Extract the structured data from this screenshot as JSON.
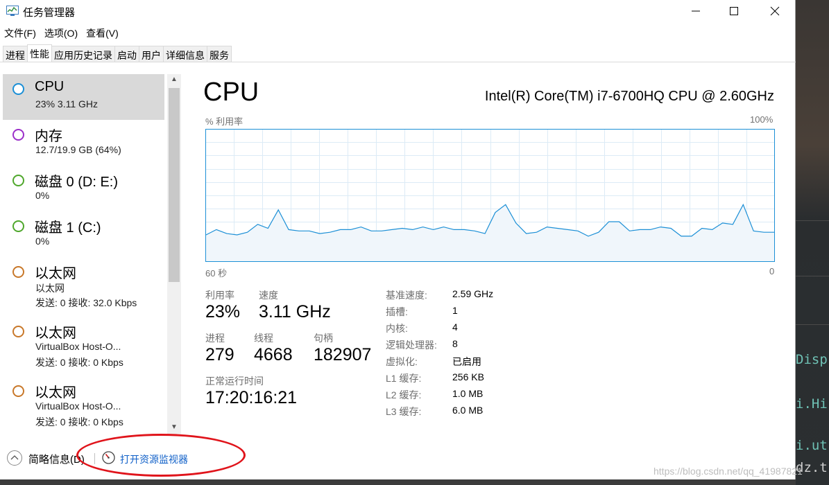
{
  "window": {
    "title": "任务管理器"
  },
  "menu": [
    "文件(F)",
    "选项(O)",
    "查看(V)"
  ],
  "tabs": [
    "进程",
    "性能",
    "应用历史记录",
    "启动",
    "用户",
    "详细信息",
    "服务"
  ],
  "active_tab": "性能",
  "sidebar": {
    "items": [
      {
        "name": "CPU",
        "line1": "23% 3.11 GHz",
        "color": "#1b8fd6"
      },
      {
        "name": "内存",
        "line1": "12.7/19.9 GB (64%)",
        "color": "#9b2fc9"
      },
      {
        "name": "磁盘 0 (D: E:)",
        "line1": "0%",
        "color": "#4fa72c"
      },
      {
        "name": "磁盘 1 (C:)",
        "line1": "0%",
        "color": "#4fa72c"
      },
      {
        "name": "以太网",
        "line1": "以太网",
        "line2": "发送: 0 接收: 32.0 Kbps",
        "color": "#c8782a"
      },
      {
        "name": "以太网",
        "line1": "VirtualBox Host-O...",
        "line2": "发送: 0 接收: 0 Kbps",
        "color": "#c8782a"
      },
      {
        "name": "以太网",
        "line1": "VirtualBox Host-O...",
        "line2": "发送: 0 接收: 0 Kbps",
        "color": "#c8782a"
      }
    ]
  },
  "main": {
    "title": "CPU",
    "model": "Intel(R) Core(TM) i7-6700HQ CPU @ 2.60GHz",
    "graph": {
      "ylabel": "% 利用率",
      "ymax_label": "100%",
      "xstart_label": "60 秒",
      "xend_label": "0"
    },
    "stats": {
      "util_label": "利用率",
      "util_value": "23%",
      "speed_label": "速度",
      "speed_value": "3.11 GHz",
      "proc_label": "进程",
      "proc_value": "279",
      "thread_label": "线程",
      "thread_value": "4668",
      "handle_label": "句柄",
      "handle_value": "182907",
      "uptime_label": "正常运行时间",
      "uptime_value": "17:20:16:21"
    },
    "details": [
      {
        "label": "基准速度:",
        "value": "2.59 GHz"
      },
      {
        "label": "插槽:",
        "value": "1"
      },
      {
        "label": "内核:",
        "value": "4"
      },
      {
        "label": "逻辑处理器:",
        "value": "8"
      },
      {
        "label": "虚拟化:",
        "value": "已启用"
      },
      {
        "label": "L1 缓存:",
        "value": "256 KB"
      },
      {
        "label": "L2 缓存:",
        "value": "1.0 MB"
      },
      {
        "label": "L3 缓存:",
        "value": "6.0 MB"
      }
    ]
  },
  "chart_data": {
    "type": "area",
    "ylim": [
      0,
      100
    ],
    "xlim": [
      60,
      0
    ],
    "values": [
      20,
      24,
      21,
      20,
      22,
      28,
      25,
      39,
      24,
      23,
      23,
      21,
      22,
      24,
      24,
      26,
      23,
      23,
      24,
      25,
      24,
      26,
      24,
      26,
      24,
      24,
      23,
      21,
      37,
      43,
      29,
      21,
      22,
      26,
      25,
      24,
      23,
      19,
      22,
      30,
      30,
      23,
      24,
      24,
      26,
      25,
      19,
      19,
      25,
      24,
      29,
      28,
      43,
      23,
      22,
      22
    ]
  },
  "footer": {
    "brief": "简略信息(D)",
    "resmon": "打开资源监视器"
  },
  "watermark": "https://blog.csdn.net/qq_41987821",
  "background_lines": [
    "Disp",
    "i.Hi",
    "i.ut",
    "dz.t"
  ],
  "colors": {
    "accent": "#1b8fd6",
    "graph_line": "#1b8fd6",
    "graph_fill": "#f0f6fb",
    "link": "#1060c8",
    "annotation": "#e0141b"
  }
}
